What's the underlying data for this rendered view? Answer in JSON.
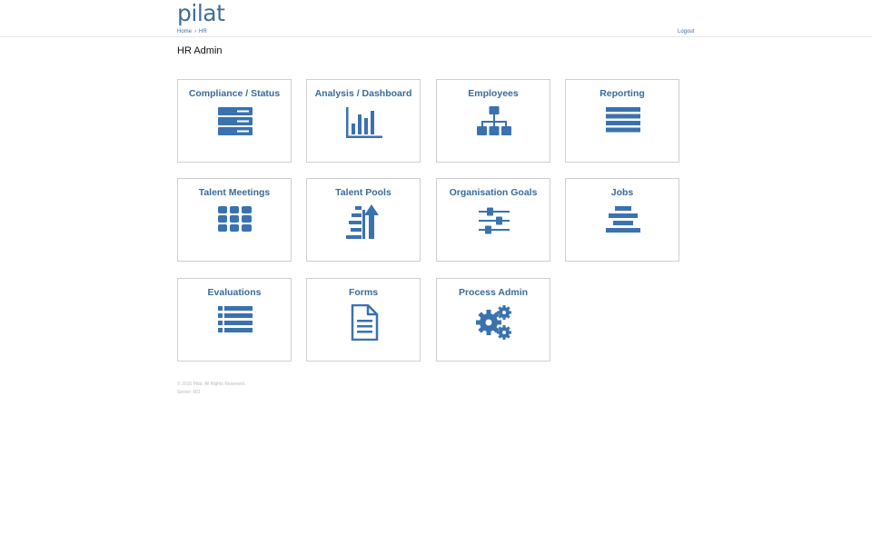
{
  "header": {
    "logo": "pilat",
    "breadcrumb": [
      "Home",
      "HR"
    ],
    "logout_label": "Logout"
  },
  "page": {
    "title": "HR Admin"
  },
  "tiles": [
    {
      "label": "Compliance / Status",
      "icon": "server-icon"
    },
    {
      "label": "Analysis / Dashboard",
      "icon": "bar-chart-icon"
    },
    {
      "label": "Employees",
      "icon": "sitemap-icon"
    },
    {
      "label": "Reporting",
      "icon": "list-bars-icon"
    },
    {
      "label": "Talent Meetings",
      "icon": "grid-icon"
    },
    {
      "label": "Talent Pools",
      "icon": "sort-up-icon"
    },
    {
      "label": "Organisation Goals",
      "icon": "sliders-icon"
    },
    {
      "label": "Jobs",
      "icon": "align-center-icon"
    },
    {
      "label": "Evaluations",
      "icon": "list-icon"
    },
    {
      "label": "Forms",
      "icon": "document-icon"
    },
    {
      "label": "Process Admin",
      "icon": "gears-icon"
    }
  ],
  "footer": {
    "line1": "© 2016 Pilat. All Rights Reserved.",
    "line2": "Server: 001"
  },
  "colors": {
    "accent": "#3a72b0",
    "label": "#3a6a9c"
  }
}
